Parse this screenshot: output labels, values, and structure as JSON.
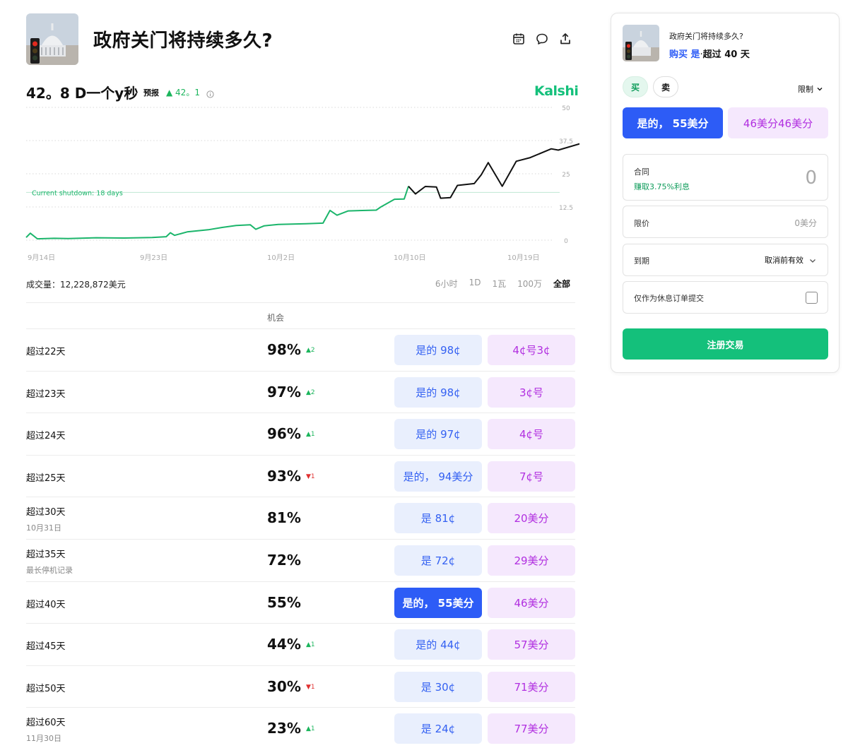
{
  "market": {
    "title": "政府关门将持续多久?",
    "thumbnail": "capitol-traffic-light-image"
  },
  "header_icons": [
    "calendar-icon",
    "comment-icon",
    "share-icon"
  ],
  "forecast": {
    "value": "42。8 D一个y秒",
    "tag": "预报",
    "change": "▲ 42。1",
    "info_icon": "info-icon",
    "brand": "Kalshi"
  },
  "chart_data": {
    "type": "line",
    "x_tick_labels": [
      "9月14日",
      "9月23日",
      "10月2日",
      "10月10日",
      "10月19日"
    ],
    "y_tick_labels": [
      "50",
      "37.5",
      "25",
      "12.5",
      "0"
    ],
    "ylim": [
      0,
      50
    ],
    "reference_line": {
      "label": "Current shutdown: 18 days",
      "value": 18
    },
    "grid": "dotted horizontal",
    "series": [
      {
        "color_segments": [
          "#1bb56b",
          "#111111"
        ],
        "x_range_days": [
          0,
          38
        ],
        "values": [
          [
            0.0,
            1.0
          ],
          [
            0.3,
            2.6
          ],
          [
            0.8,
            0.5
          ],
          [
            2.0,
            0.7
          ],
          [
            3.0,
            0.6
          ],
          [
            5.0,
            0.9
          ],
          [
            7.0,
            0.8
          ],
          [
            9.0,
            1.0
          ],
          [
            10.0,
            1.3
          ],
          [
            10.3,
            2.8
          ],
          [
            10.6,
            1.8
          ],
          [
            11.5,
            3.1
          ],
          [
            13.0,
            3.9
          ],
          [
            14.0,
            4.8
          ],
          [
            15.0,
            5.5
          ],
          [
            16.0,
            5.8
          ],
          [
            16.4,
            4.1
          ],
          [
            17.0,
            5.4
          ],
          [
            18.0,
            5.9
          ],
          [
            20.0,
            6.2
          ],
          [
            21.2,
            6.4
          ],
          [
            21.7,
            11.2
          ],
          [
            22.2,
            9.4
          ],
          [
            23.0,
            11.0
          ],
          [
            25.0,
            11.3
          ],
          [
            25.3,
            12.4
          ],
          [
            26.3,
            15.4
          ],
          [
            27.0,
            15.5
          ],
          [
            27.3,
            20.3
          ],
          [
            27.8,
            17.4
          ],
          [
            28.5,
            20.2
          ],
          [
            29.3,
            20.0
          ],
          [
            29.6,
            15.8
          ],
          [
            30.3,
            16.0
          ],
          [
            30.8,
            20.6
          ],
          [
            32.0,
            21.3
          ],
          [
            32.5,
            24.6
          ],
          [
            33.0,
            29.2
          ],
          [
            34.0,
            20.3
          ],
          [
            35.0,
            29.7
          ],
          [
            36.0,
            31.1
          ],
          [
            37.5,
            34.4
          ],
          [
            38.0,
            33.9
          ],
          [
            40.0,
            37.0
          ],
          [
            42.0,
            39.5
          ],
          [
            45.0,
            41.0
          ],
          [
            46.0,
            42.9
          ],
          [
            48.0,
            42.5
          ]
        ]
      }
    ]
  },
  "volume": "成交量：12,228,872美元",
  "ranges": [
    "6小时",
    "1D",
    "1瓦",
    "100万",
    "全部"
  ],
  "active_range": "全部",
  "table": {
    "column_header": "机会",
    "rows": [
      {
        "label": "超过22天",
        "sub": "",
        "pct": "98%",
        "delta": "▲2",
        "dir": "up",
        "yes": "是的 98¢",
        "no": "4¢号3¢",
        "selected": false
      },
      {
        "label": "超过23天",
        "sub": "",
        "pct": "97%",
        "delta": "▲2",
        "dir": "up",
        "yes": "是的 98¢",
        "no": "3¢号",
        "selected": false
      },
      {
        "label": "超过24天",
        "sub": "",
        "pct": "96%",
        "delta": "▲1",
        "dir": "up",
        "yes": "是的 97¢",
        "no": "4¢号",
        "selected": false
      },
      {
        "label": "超过25天",
        "sub": "",
        "pct": "93%",
        "delta": "▼1",
        "dir": "down",
        "yes": "是的， 94美分",
        "no": "7¢号",
        "selected": false
      },
      {
        "label": "超过30天",
        "sub": "10月31日",
        "pct": "81%",
        "delta": "",
        "dir": "",
        "yes": "是 81¢",
        "no": "20美分",
        "selected": false
      },
      {
        "label": "超过35天",
        "sub": "最长停机记录",
        "pct": "72%",
        "delta": "",
        "dir": "",
        "yes": "是 72¢",
        "no": "29美分",
        "selected": false
      },
      {
        "label": "超过40天",
        "sub": "",
        "pct": "55%",
        "delta": "",
        "dir": "",
        "yes": "是的， 55美分",
        "no": "46美分",
        "selected": true
      },
      {
        "label": "超过45天",
        "sub": "",
        "pct": "44%",
        "delta": "▲1",
        "dir": "up",
        "yes": "是的 44¢",
        "no": "57美分",
        "selected": false
      },
      {
        "label": "超过50天",
        "sub": "",
        "pct": "30%",
        "delta": "▼1",
        "dir": "down",
        "yes": "是 30¢",
        "no": "71美分",
        "selected": false
      },
      {
        "label": "超过60天",
        "sub": "11月30日",
        "pct": "23%",
        "delta": "▲1",
        "dir": "up",
        "yes": "是 24¢",
        "no": "77美分",
        "selected": false
      }
    ]
  },
  "panel": {
    "title": "政府关门将持续多久?",
    "buy_yes": "购买 是",
    "dot": "·",
    "outcome": "超过 40 天",
    "buy": "买",
    "sell": "卖",
    "order_type": "限制",
    "yes_button": "是的， 55美分",
    "no_button": "46美分46美分",
    "contracts_label": "合同",
    "interest": "赚取3.75%利息",
    "contracts_value": "0",
    "limit_label": "限价",
    "limit_value": "0美分",
    "expiry_label": "到期",
    "expiry_value": "取消前有效",
    "rest_only": "仅作为休息订单提交",
    "submit": "注册交易"
  },
  "colors": {
    "brand": "#14c07b",
    "yes_bg": "#e9effd",
    "yes_text": "#3461f2",
    "yes_selected": "#2d5cf6",
    "no_bg": "#f5e8fd",
    "no_text": "#b12fe0",
    "up": "#1bb55c",
    "down": "#e03030"
  }
}
